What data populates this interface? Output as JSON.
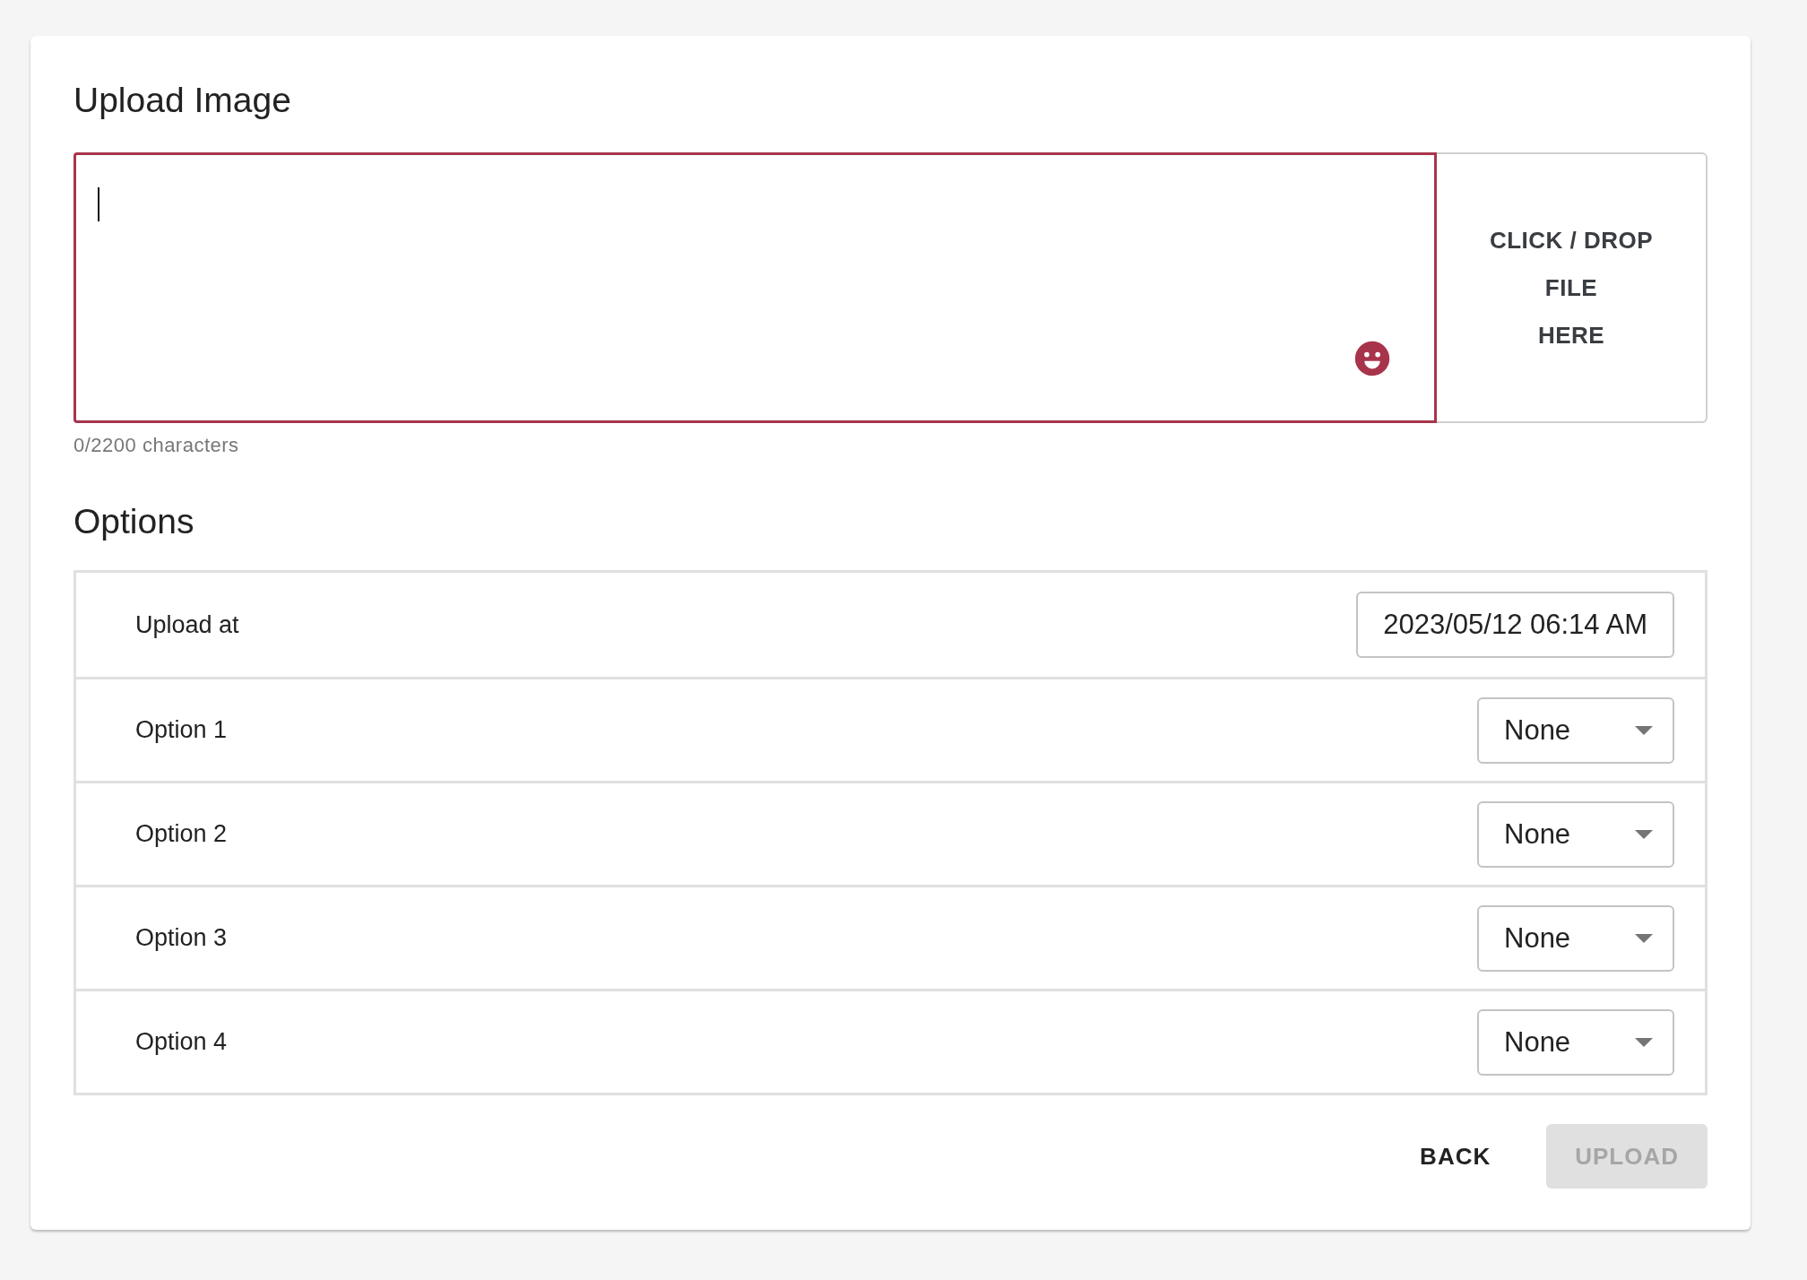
{
  "title": "Upload Image",
  "caption_field": {
    "focused": true,
    "counter": "0/2200 characters"
  },
  "dropzone": {
    "lines": [
      "CLICK / DROP",
      "FILE",
      "HERE"
    ]
  },
  "options_title": "Options",
  "options": [
    {
      "label": "Upload at",
      "kind": "datetime",
      "value": "2023/05/12 06:14 AM"
    },
    {
      "label": "Option 1",
      "kind": "select",
      "value": "None"
    },
    {
      "label": "Option 2",
      "kind": "select",
      "value": "None"
    },
    {
      "label": "Option 3",
      "kind": "select",
      "value": "None"
    },
    {
      "label": "Option 4",
      "kind": "select",
      "value": "None"
    }
  ],
  "buttons": [
    {
      "label": "BACK",
      "kind": "text",
      "disabled": false
    },
    {
      "label": "UPLOAD",
      "kind": "contained",
      "disabled": true
    }
  ]
}
